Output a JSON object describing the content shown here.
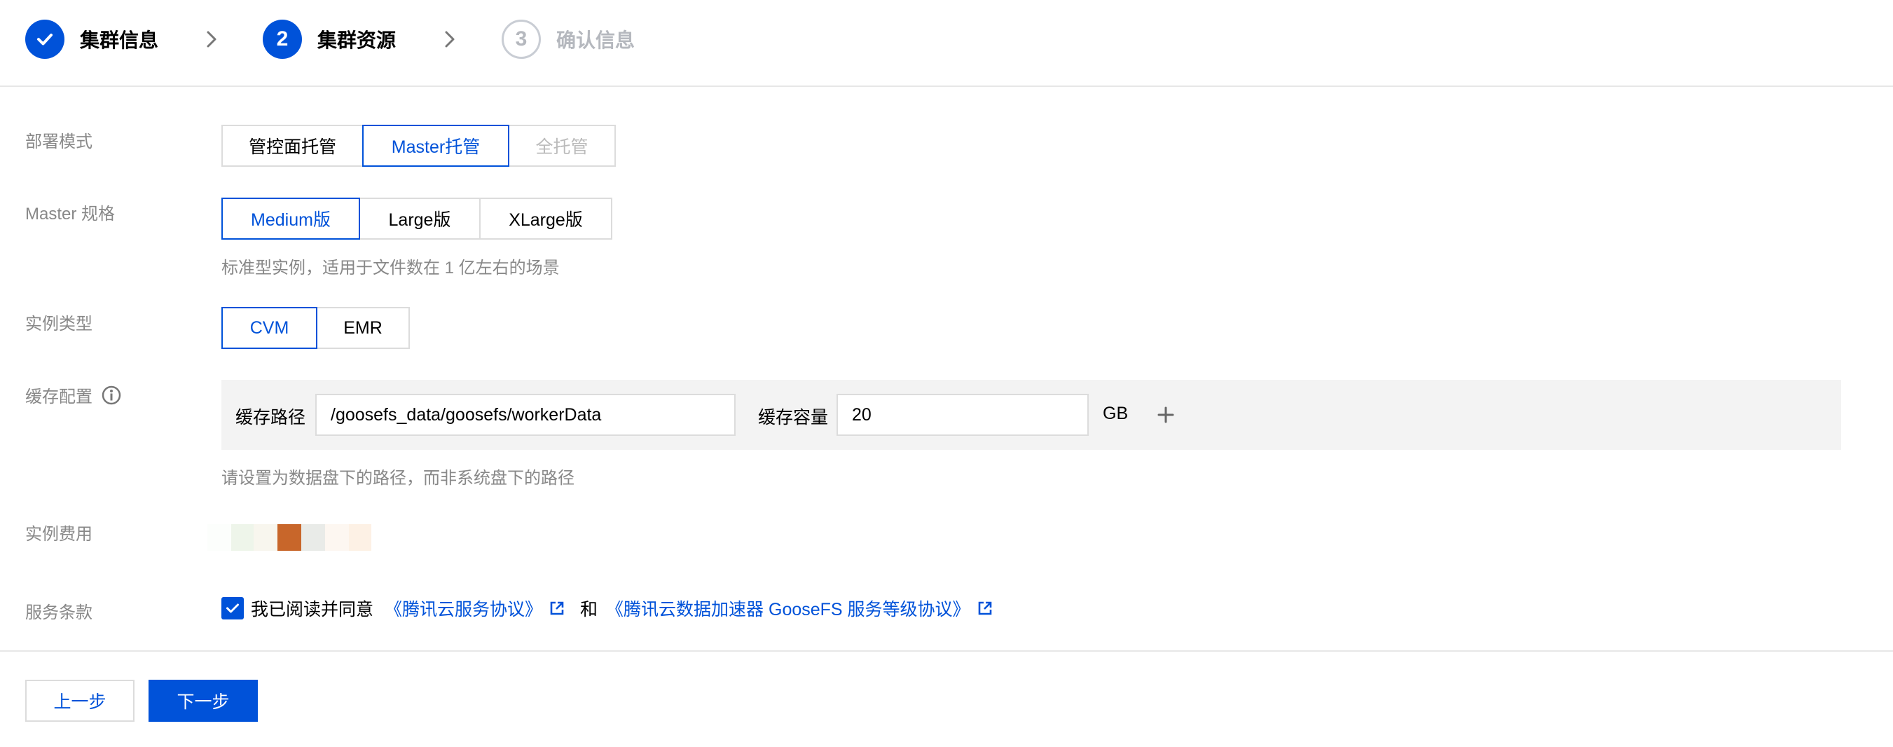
{
  "steps": [
    {
      "label": "集群信息",
      "number": "",
      "state": "done"
    },
    {
      "label": "集群资源",
      "number": "2",
      "state": "active"
    },
    {
      "label": "确认信息",
      "number": "3",
      "state": "todo"
    }
  ],
  "form": {
    "deploy_mode": {
      "label": "部署模式",
      "options": [
        "管控面托管",
        "Master托管",
        "全托管"
      ],
      "selected": "Master托管",
      "disabled": "全托管"
    },
    "master_spec": {
      "label": "Master 规格",
      "options": [
        "Medium版",
        "Large版",
        "XLarge版"
      ],
      "selected": "Medium版",
      "hint": "标准型实例，适用于文件数在 1 亿左右的场景"
    },
    "instance_type": {
      "label": "实例类型",
      "options": [
        "CVM",
        "EMR"
      ],
      "selected": "CVM"
    },
    "cache": {
      "label": "缓存配置",
      "path_label": "缓存路径",
      "path_value": "/goosefs_data/goosefs/workerData",
      "capacity_label": "缓存容量",
      "capacity_value": "20",
      "unit": "GB",
      "hint": "请设置为数据盘下的路径，而非系统盘下的路径"
    },
    "fee": {
      "label": "实例费用"
    },
    "terms": {
      "label": "服务条款",
      "checked": true,
      "prefix": "我已阅读并同意",
      "link1": "《腾讯云服务协议》",
      "and": "和",
      "link2": "《腾讯云数据加速器 GooseFS 服务等级协议》"
    }
  },
  "footer": {
    "prev_label": "上一步",
    "next_label": "下一步"
  },
  "colors": {
    "primary": "#0052d9",
    "border": "#dcdcdc",
    "muted": "#888888",
    "panel_bg": "#f3f3f3",
    "fee_blur_accent": "#c8662a"
  }
}
